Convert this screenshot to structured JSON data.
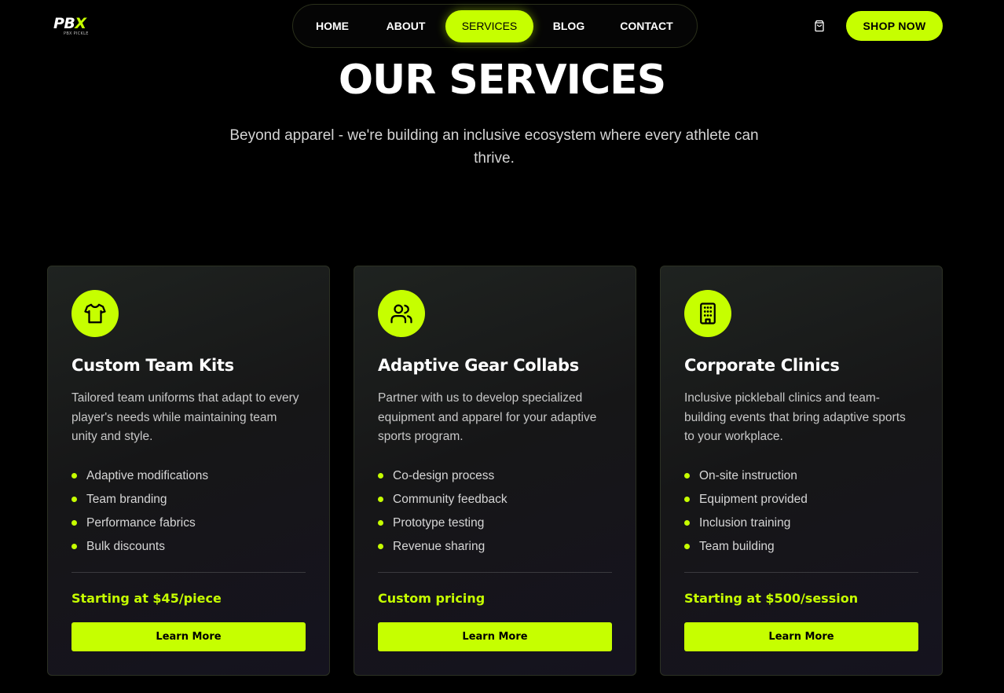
{
  "brand": {
    "logo_text": "PB",
    "logo_x": "X",
    "logo_sub": "PBX PICKLE"
  },
  "nav": {
    "items": [
      {
        "label": "HOME"
      },
      {
        "label": "ABOUT"
      },
      {
        "label": "SERVICES",
        "active": true
      },
      {
        "label": "BLOG"
      },
      {
        "label": "CONTACT"
      }
    ]
  },
  "header": {
    "cart_icon": "shopping-bag-icon",
    "shop_label": "SHOP NOW"
  },
  "hero": {
    "title": "OUR SERVICES",
    "subtitle": "Beyond apparel - we're building an inclusive ecosystem where every athlete can thrive."
  },
  "colors": {
    "accent": "#c6ff00",
    "background": "#000000"
  },
  "services": [
    {
      "icon": "shirt-icon",
      "title": "Custom Team Kits",
      "description": "Tailored team uniforms that adapt to every player's needs while maintaining team unity and style.",
      "features": [
        "Adaptive modifications",
        "Team branding",
        "Performance fabrics",
        "Bulk discounts"
      ],
      "price": "Starting at $45/piece",
      "cta": "Learn More"
    },
    {
      "icon": "users-icon",
      "title": "Adaptive Gear Collabs",
      "description": "Partner with us to develop specialized equipment and apparel for your adaptive sports program.",
      "features": [
        "Co-design process",
        "Community feedback",
        "Prototype testing",
        "Revenue sharing"
      ],
      "price": "Custom pricing",
      "cta": "Learn More"
    },
    {
      "icon": "building-icon",
      "title": "Corporate Clinics",
      "description": "Inclusive pickleball clinics and team-building events that bring adaptive sports to your workplace.",
      "features": [
        "On-site instruction",
        "Equipment provided",
        "Inclusion training",
        "Team building"
      ],
      "price": "Starting at $500/session",
      "cta": "Learn More"
    }
  ]
}
